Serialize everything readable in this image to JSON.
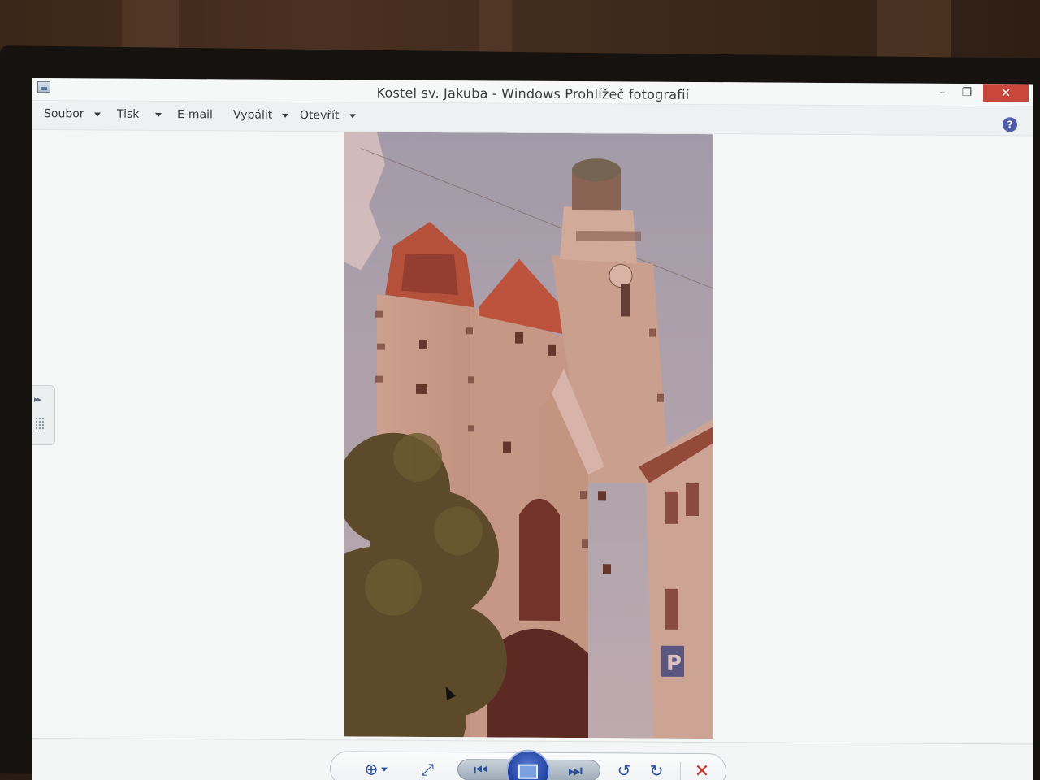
{
  "window": {
    "title": "Kostel sv. Jakuba - Windows Prohlížeč fotografií",
    "controls": {
      "minimize": "–",
      "maximize": "❐",
      "close": "✕"
    }
  },
  "menubar": {
    "items": [
      {
        "label": "Soubor",
        "has_dropdown": true
      },
      {
        "label": "Tisk",
        "has_dropdown": true
      },
      {
        "label": "E-mail",
        "has_dropdown": false
      },
      {
        "label": "Vypálit",
        "has_dropdown": true
      },
      {
        "label": "Otevřít",
        "has_dropdown": true
      }
    ],
    "help_icon": "?"
  },
  "side_panel": {
    "arrows": "▸▸",
    "icon": "expand-panel-icon"
  },
  "photo": {
    "subject": "church-tower-photo"
  },
  "toolbar": {
    "zoom_icon": "⊕",
    "fit_icon": "⤢",
    "prev_icon": "⏮",
    "next_icon": "⏭",
    "rotate_left_icon": "↺",
    "rotate_right_icon": "↻",
    "delete_icon": "✕"
  },
  "colors": {
    "close_button": "#c8463c",
    "accent_blue": "#2b4f9a",
    "delete_red": "#c9302a"
  }
}
